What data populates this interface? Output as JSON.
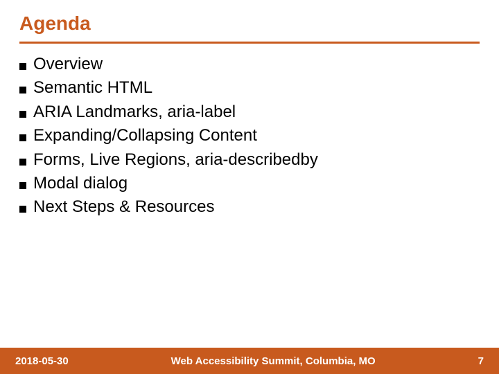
{
  "title": "Agenda",
  "items": [
    "Overview",
    "Semantic HTML",
    "ARIA Landmarks, aria-label",
    "Expanding/Collapsing Content",
    "Forms, Live Regions, aria-describedby",
    "Modal dialog",
    "Next Steps & Resources"
  ],
  "footer": {
    "date": "2018-05-30",
    "center": "Web Accessibility Summit, Columbia, MO",
    "page": "7"
  },
  "colors": {
    "accent": "#c85a1e"
  }
}
